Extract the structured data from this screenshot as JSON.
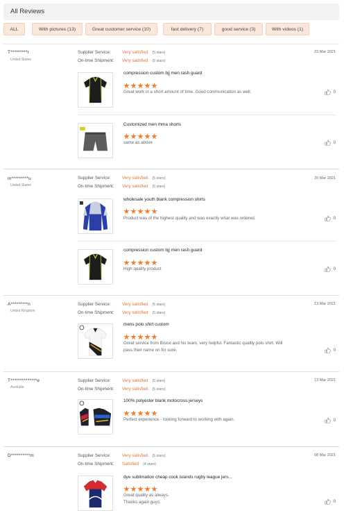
{
  "header": {
    "title": "All Reviews"
  },
  "filters": [
    {
      "label": "ALL"
    },
    {
      "label": "With pictures (13)"
    },
    {
      "label": "Great customer service (10)"
    },
    {
      "label": "fast delivery (7)"
    },
    {
      "label": "good service (3)"
    },
    {
      "label": "With videos (1)"
    }
  ],
  "labels": {
    "supplier": "Supplier Service:",
    "shipment": "On-time Shipment:"
  },
  "reviews": [
    {
      "user": "T*********r",
      "country": "United States",
      "date": "23 Mar 2021",
      "supplier": "Very satisfied",
      "supplier_stars": "(5 stars)",
      "shipment": "Very satisfied",
      "shipment_stars": "(5 stars)",
      "items": [
        {
          "title": "compression custom bjj men rash guard",
          "comment": "Great work in a short amount of time.  Good communication as well.",
          "likes": "0",
          "rating": 5,
          "image": "rashguard-icon"
        },
        {
          "title": "Customized men mma shorts",
          "comment": "same as above",
          "likes": "0",
          "rating": 5,
          "image": "shorts-icon"
        }
      ]
    },
    {
      "user": "m*********u",
      "country": "United States",
      "date": "20 Mar 2021",
      "supplier": "Very satisfied",
      "supplier_stars": "(5 stars)",
      "shipment": "Very satisfied",
      "shipment_stars": "(5 stars)",
      "items": [
        {
          "title": "wholesale youth blank compression shirts",
          "comment": "Product was of the highest quality and was exactly what was ordered.",
          "likes": "0",
          "rating": 5,
          "image": "compression-shirt-icon"
        },
        {
          "title": "compression custom bjj men rash guard",
          "comment": "High quality product",
          "likes": "0",
          "rating": 5,
          "image": "rashguard-icon"
        }
      ]
    },
    {
      "user": "A*********n",
      "country": "United Kingdom",
      "date": "13 Mar 2021",
      "supplier": "Very satisfied",
      "supplier_stars": "(5 stars)",
      "shipment": "Very satisfied",
      "shipment_stars": "(5 stars)",
      "items": [
        {
          "title": "mens polo shirt custom",
          "comment": "Great service from Bruce and his team, very helpful. Fantastic quality polo shirt. Will pass their name on for sure.",
          "likes": "0",
          "rating": 5,
          "image": "polo-shirt-icon"
        }
      ]
    },
    {
      "user": "T**************e",
      "country": "Australia",
      "date": "13 Mar 2021",
      "supplier": "Very satisfied",
      "supplier_stars": "(5 stars)",
      "shipment": "Very satisfied",
      "shipment_stars": "(5 stars)",
      "items": [
        {
          "title": "100% polyester blank motocross jerseys",
          "comment": "Perfect experience - looking forward to working with again.",
          "likes": "0",
          "rating": 5,
          "image": "motocross-jersey-icon"
        }
      ]
    },
    {
      "user": "D**********m",
      "country": "",
      "date": "08 Mar 2021",
      "supplier": "Very satisfied",
      "supplier_stars": "(5 stars)",
      "shipment": "Satisfied",
      "shipment_stars": "(4 stars)",
      "items": [
        {
          "title": "dye sublimation cheap cook islands rugby league jers...",
          "comment": "Great quality as always.\nThanks again guys.",
          "likes": "0",
          "rating": 5,
          "image": "rugby-jersey-icon"
        }
      ]
    }
  ],
  "colors": {
    "accent": "#e2703a",
    "star": "#f07d2a",
    "chip_bg": "#fbe7dc"
  }
}
